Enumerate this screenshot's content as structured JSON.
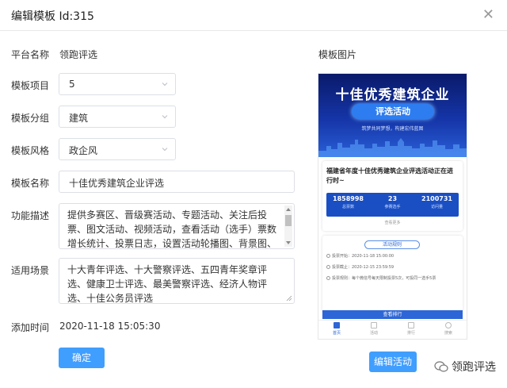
{
  "dialog": {
    "title": "编辑模板 Id:315"
  },
  "form": {
    "platform": {
      "label": "平台名称",
      "value": "领跑评选"
    },
    "item": {
      "label": "模板项目",
      "value": "5"
    },
    "group": {
      "label": "模板分组",
      "value": "建筑"
    },
    "style": {
      "label": "模板风格",
      "value": "政企风"
    },
    "name": {
      "label": "模板名称",
      "value": "十佳优秀建筑企业评选"
    },
    "desc": {
      "label": "功能描述",
      "value": "提供多赛区、晋级赛活动、专题活动、关注后投票、图文活动、视频活动，查看活动（选手）票数增长统计、投票日志，设置活动轮播图、背景图、漂浮物、..."
    },
    "scene": {
      "label": "适用场景",
      "value": "十大青年评选、十大警察评选、五四青年奖章评选、健康卫士评选、最美警察评选、经济人物评选、十佳公务员评选"
    },
    "added": {
      "label": "添加时间",
      "value": "2020-11-18 15:05:30"
    }
  },
  "buttons": {
    "confirm": "确定",
    "edit_activity": "编辑活动"
  },
  "preview": {
    "label": "模板图片",
    "banner_title": "十佳优秀建筑企业",
    "banner_subtitle": "评选活动",
    "banner_slogan": "筑梦共同梦想，构建宏伟蓝图",
    "card_title": "福建省年度十佳优秀建筑企业评选活动正在进行时~",
    "stats": [
      {
        "num": "1858998",
        "cap": "总票数"
      },
      {
        "num": "23",
        "cap": "参赛选手"
      },
      {
        "num": "2100731",
        "cap": "访问量"
      }
    ],
    "more": "查看更多",
    "rules_title": "活动规则",
    "rules": [
      "投票开始：2020-11-18 15:00:00",
      "投票截止：2020-12-15 23:59:59",
      "投票规则：每个微信号每天限制投票5次，可投同一选手5票"
    ],
    "rank": "查看排行",
    "tabs": [
      "首页",
      "活动",
      "排行",
      "搜索"
    ]
  },
  "watermark": "领跑评选",
  "colors": {
    "primary": "#409eff",
    "banner": "#1535a8"
  }
}
